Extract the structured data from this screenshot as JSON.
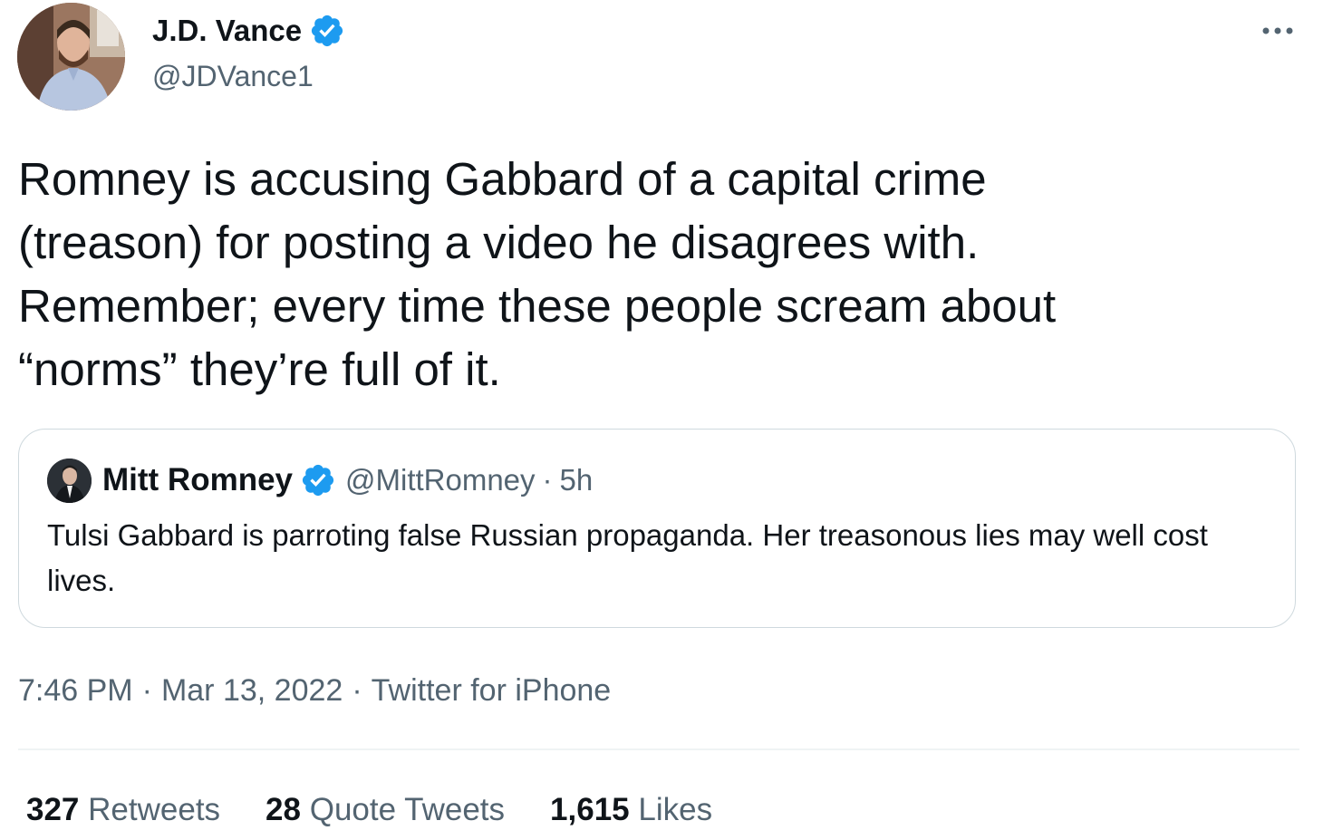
{
  "author": {
    "name": "J.D. Vance",
    "handle": "@JDVance1",
    "verified": true
  },
  "tweet": {
    "text": "Romney is accusing Gabbard of a capital crime\n(treason) for posting a video he disagrees with.\nRemember; every time these people scream about\n“norms” they’re full of it."
  },
  "quoted_tweet": {
    "name": "Mitt Romney",
    "handle": "@MittRomney",
    "separator": "·",
    "time": "5h",
    "verified": true,
    "text": "Tulsi Gabbard is parroting false Russian propaganda. Her treasonous lies may well cost lives."
  },
  "meta": {
    "time": "7:46 PM",
    "separator": "·",
    "date": "Mar 13, 2022",
    "source": "Twitter for iPhone"
  },
  "stats": {
    "retweets_count": "327",
    "retweets_label": "Retweets",
    "quotes_count": "28",
    "quotes_label": "Quote Tweets",
    "likes_count": "1,615",
    "likes_label": "Likes"
  },
  "colors": {
    "verified_blue": "#1d9bf0",
    "text_primary": "#0f1419",
    "text_secondary": "#536471",
    "border": "#cfd9de"
  },
  "icons": {
    "verified": "verified-badge-icon",
    "more": "more-options-icon"
  }
}
